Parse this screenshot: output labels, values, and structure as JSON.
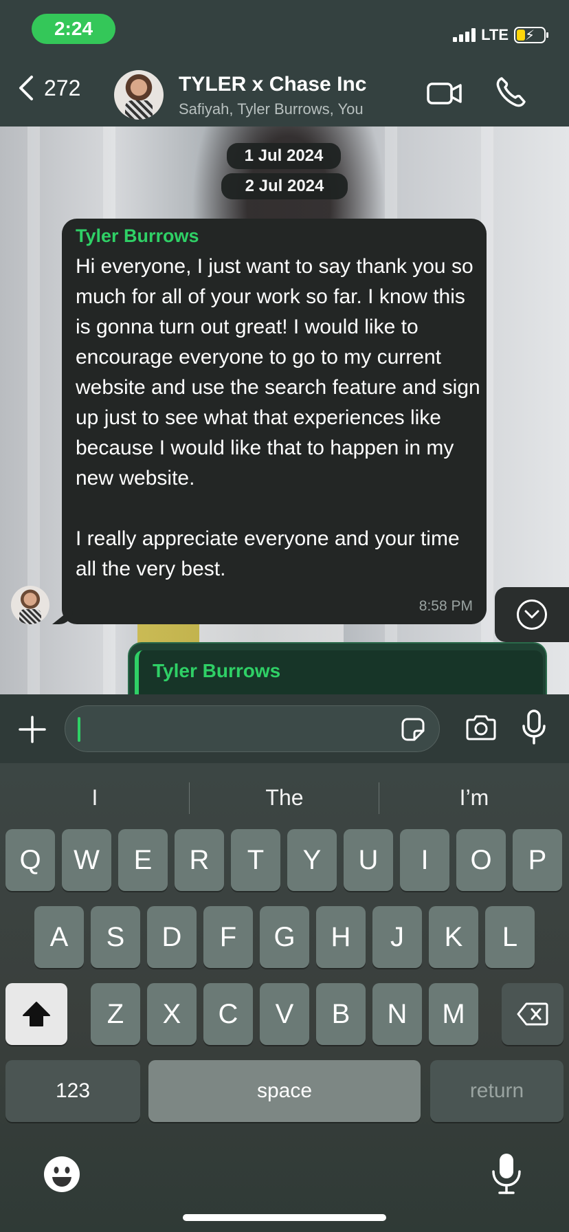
{
  "status_bar": {
    "time": "2:24",
    "network": "LTE"
  },
  "header": {
    "back_count": "272",
    "title": "TYLER x Chase Inc",
    "subtitle": "Safiyah, Tyler Burrows, You"
  },
  "dates": [
    "1 Jul 2024",
    "2 Jul 2024"
  ],
  "message": {
    "sender": "Tyler Burrows",
    "text": "Hi everyone, I just want to say thank you so much for all of your work so far. I know this is gonna turn out great! I would like to encourage everyone to go to my current website and use the search feature and sign up just to see what that experiences like because I would like that to happen in my new website.\n\nI really appreciate everyone and your time all the very best.",
    "time": "8:58 PM"
  },
  "reply_preview": {
    "sender": "Tyler Burrows"
  },
  "composer": {
    "value": "",
    "placeholder": ""
  },
  "keyboard": {
    "suggestions": [
      "I",
      "The",
      "I’m"
    ],
    "row1": [
      "Q",
      "W",
      "E",
      "R",
      "T",
      "Y",
      "U",
      "I",
      "O",
      "P"
    ],
    "row2": [
      "A",
      "S",
      "D",
      "F",
      "G",
      "H",
      "J",
      "K",
      "L"
    ],
    "row3": [
      "Z",
      "X",
      "C",
      "V",
      "B",
      "N",
      "M"
    ],
    "numbers_label": "123",
    "space_label": "space",
    "return_label": "return"
  },
  "colors": {
    "accent_green": "#2fd066",
    "time_pill": "#34c759",
    "bubble": "#232625"
  }
}
